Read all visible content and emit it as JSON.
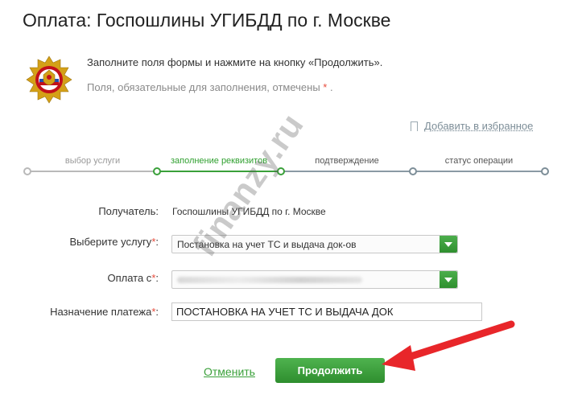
{
  "page": {
    "title": "Оплата: Госпошлины УГИБДД по г. Москве",
    "instruction": "Заполните поля формы и нажмите на кнопку «Продолжить».",
    "required_note": "Поля, обязательные для заполнения, отмечены",
    "required_star": "*",
    "required_note_end": ".",
    "favorite_link": "Добавить в избранное"
  },
  "steps": [
    {
      "label": "выбор услуги",
      "state": "done"
    },
    {
      "label": "заполнение реквизитов",
      "state": "active"
    },
    {
      "label": "подтверждение",
      "state": "pending"
    },
    {
      "label": "статус операции",
      "state": "pending"
    }
  ],
  "form": {
    "recipient_label": "Получатель:",
    "recipient_value": "Госпошлины УГИБДД по г. Москве",
    "service_label": "Выберите услугу",
    "service_value": "Постановка на учет ТС и выдача док-ов",
    "payment_from_label": "Оплата с",
    "purpose_label": "Назначение платежа",
    "purpose_value": "ПОСТАНОВКА НА УЧЕТ ТС И ВЫДАЧА ДОК",
    "required_star": "*",
    "colon": ":"
  },
  "actions": {
    "cancel": "Отменить",
    "continue": "Продолжить"
  },
  "watermark": "finanzy.ru",
  "colors": {
    "accent_green": "#30a030",
    "arrow_red": "#e8262a",
    "required": "#e74c3c"
  }
}
